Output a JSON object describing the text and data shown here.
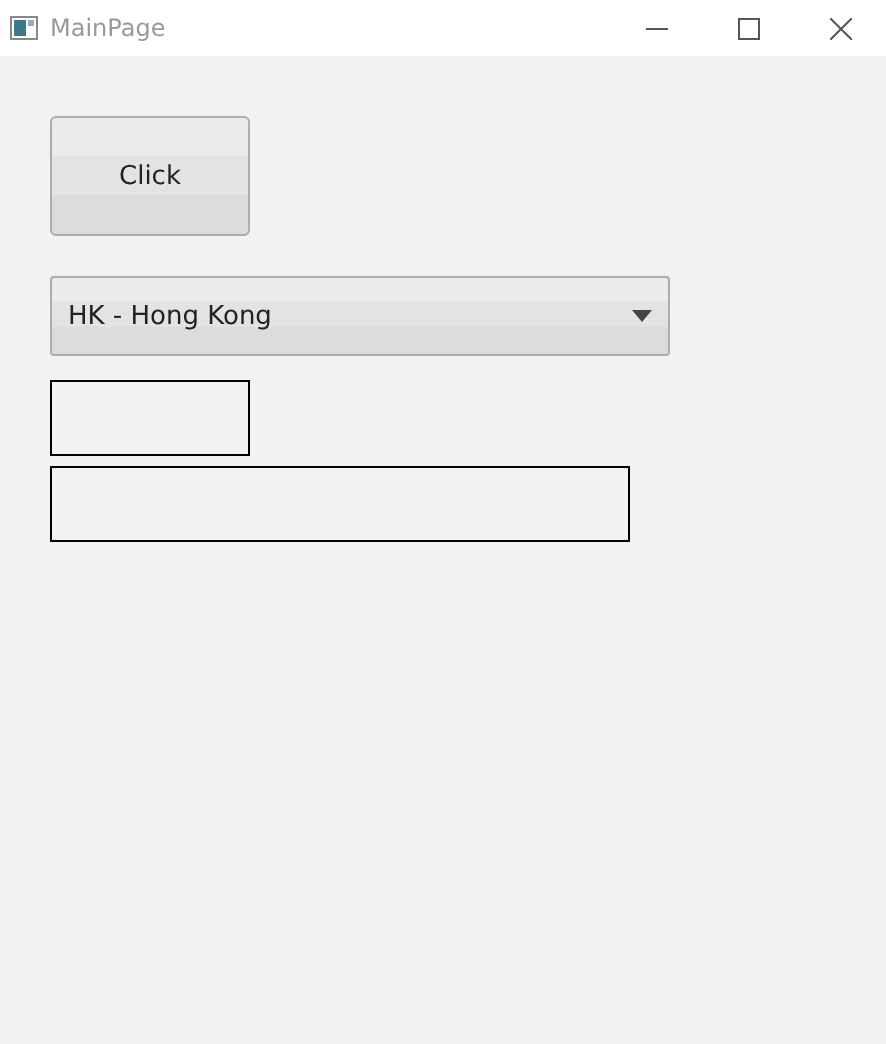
{
  "window": {
    "title": "MainPage"
  },
  "button": {
    "label": "Click"
  },
  "dropdown": {
    "value": "HK - Hong Kong"
  },
  "boxes": [
    {
      "kind": "small"
    },
    {
      "kind": "wide"
    }
  ]
}
